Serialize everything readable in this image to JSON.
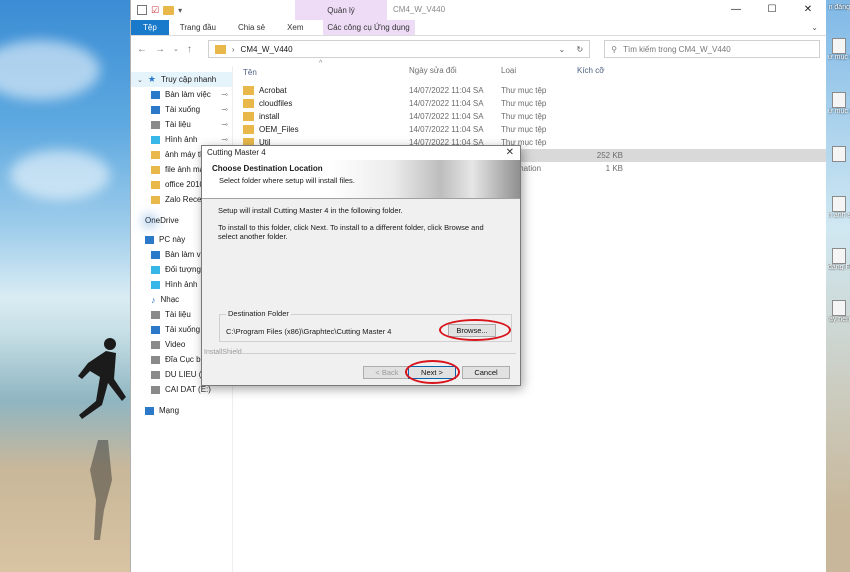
{
  "explorer": {
    "window_title": "CM4_W_V440",
    "context_group": "Quản lý",
    "ribbon_tabs": [
      "Tệp",
      "Trang đầu",
      "Chia sẻ",
      "Xem"
    ],
    "context_tab": "Các công cụ Ứng dụng",
    "address": "CM4_W_V440",
    "search_placeholder": "Tìm kiếm trong CM4_W_V440",
    "nav": {
      "quick_access": "Truy cập nhanh",
      "quick_items": [
        "Bàn làm việc",
        "Tài xuống",
        "Tài liệu",
        "Hình ảnh",
        "ảnh máy th",
        "file ảnh ma",
        "office 2010",
        "Zalo Receiv"
      ],
      "onedrive": "OneDrive",
      "this_pc": "PC này",
      "pc_items": [
        "Bàn làm việ",
        "Đối tượng 3",
        "Hình ảnh",
        "Nhạc",
        "Tài liệu",
        "Tải xuống",
        "Video",
        "Đĩa Cục bộ",
        "DU LIEU (D:",
        "CAI DAT (E:)"
      ],
      "network": "Mạng"
    },
    "columns": {
      "name": "Tên",
      "date": "Ngày sửa đổi",
      "type": "Loại",
      "size": "Kích cỡ"
    },
    "files": [
      {
        "name": "Acrobat",
        "date": "14/07/2022 11:04 SA",
        "type": "Thư mục tệp",
        "size": ""
      },
      {
        "name": "cloudfiles",
        "date": "14/07/2022 11:04 SA",
        "type": "Thư mục tệp",
        "size": ""
      },
      {
        "name": "install",
        "date": "14/07/2022 11:04 SA",
        "type": "Thư mục tệp",
        "size": ""
      },
      {
        "name": "OEM_Files",
        "date": "14/07/2022 11:04 SA",
        "type": "Thư mục tệp",
        "size": ""
      },
      {
        "name": "Util",
        "date": "14/07/2022 11:04 SA",
        "type": "Thư mục tệp",
        "size": ""
      },
      {
        "name": "",
        "date": "",
        "type": "dung",
        "size": "252 KB"
      },
      {
        "name": "",
        "date": "",
        "type": "Information",
        "size": "1 KB"
      }
    ]
  },
  "dialog": {
    "title": "Cutting Master 4",
    "close": "✕",
    "header_title": "Choose Destination Location",
    "header_subtitle": "Select folder where setup will install files.",
    "line1": "Setup will install Cutting Master 4 in the following folder.",
    "line2": "To install to this folder, click Next. To install to a different folder, click Browse and select another folder.",
    "dest_label": "Destination Folder",
    "dest_path": "C:\\Program Files (x86)\\Graphtec\\Cutting Master 4",
    "browse": "Browse...",
    "installshield": "InstallShield",
    "back": "< Back",
    "next": "Next >",
    "cancel": "Cancel"
  },
  "desktop_labels": [
    "n đăng",
    "ư mục c (2)",
    "ư mục c (3)",
    "",
    "n ảnh so v",
    "đăng FB",
    "ay nền"
  ]
}
